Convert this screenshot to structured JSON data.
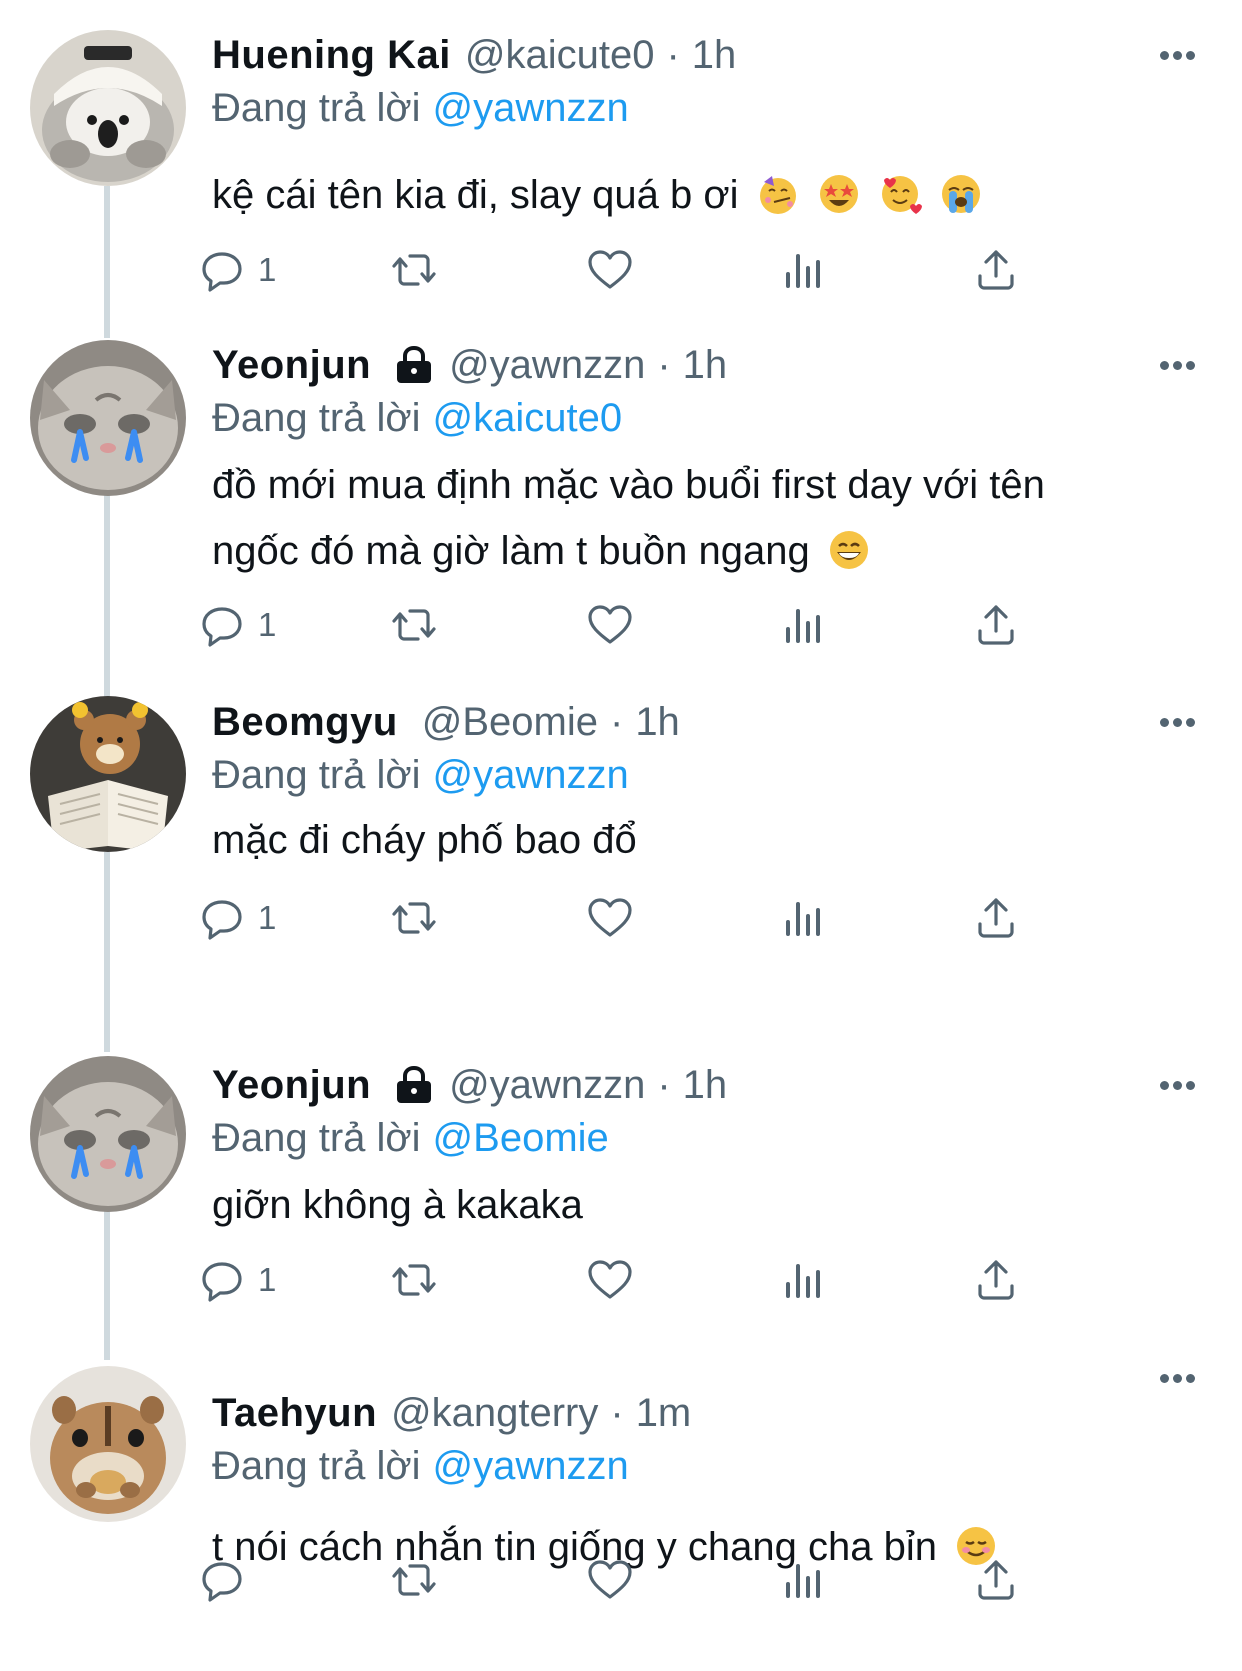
{
  "colors": {
    "link": "#1d9bf0",
    "muted": "#536471",
    "text": "#0f1419",
    "thread": "#cfd9de"
  },
  "tweets": [
    {
      "name": "Huening Kai",
      "locked": false,
      "handle": "@kaicute0",
      "time": "1h",
      "reply_prefix": "Đang trả lời",
      "reply_to": "@yawnzzn",
      "text": "kệ cái tên kia đi, slay quá b ơi",
      "emojis": [
        "partying-face-emoji",
        "star-struck-emoji",
        "smiling-face-with-hearts-emoji",
        "loudly-crying-face-emoji"
      ],
      "reply_count": "1",
      "avatar": "bird-plush-avatar"
    },
    {
      "name": "Yeonjun",
      "locked": true,
      "handle": "@yawnzzn",
      "time": "1h",
      "reply_prefix": "Đang trả lời",
      "reply_to": "@kaicute0",
      "text": "đồ mới mua định mặc vào buổi first day với tên ngốc đó mà giờ làm t buồn ngang",
      "emojis": [
        "grinning-face-emoji"
      ],
      "reply_count": "1",
      "avatar": "crying-kitten-avatar"
    },
    {
      "name": "Beomgyu",
      "locked": false,
      "handle": "@Beomie",
      "time": "1h",
      "reply_prefix": "Đang trả lời",
      "reply_to": "@yawnzzn",
      "text": "mặc đi cháy phố bao đổ",
      "emojis": [],
      "reply_count": "1",
      "avatar": "rilakkuma-book-avatar"
    },
    {
      "name": "Yeonjun",
      "locked": true,
      "handle": "@yawnzzn",
      "time": "1h",
      "reply_prefix": "Đang trả lời",
      "reply_to": "@Beomie",
      "text": "giỡn không à kakaka",
      "emojis": [],
      "reply_count": "1",
      "avatar": "crying-kitten-avatar"
    },
    {
      "name": "Taehyun",
      "locked": false,
      "handle": "@kangterry",
      "time": "1m",
      "reply_prefix": "Đang trả lời",
      "reply_to": "@yawnzzn",
      "text": "t nói cách nhắn tin giống y chang cha bỉn",
      "emojis": [
        "smiling-face-emoji"
      ],
      "reply_count": "",
      "avatar": "chipmunk-avatar"
    }
  ]
}
